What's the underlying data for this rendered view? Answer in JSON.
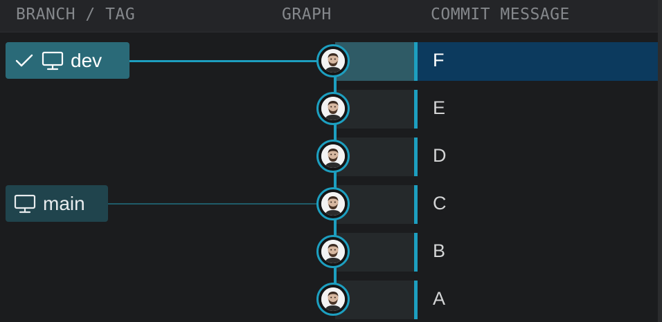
{
  "header": {
    "branch_tag": "BRANCH / TAG",
    "graph": "GRAPH",
    "commit_message": "COMMIT MESSAGE"
  },
  "branches": [
    {
      "name": "dev",
      "is_current": true,
      "icons": [
        "checkmark-icon",
        "computer-icon"
      ]
    },
    {
      "name": "main",
      "is_current": false,
      "icons": [
        "computer-icon"
      ]
    }
  ],
  "commits": [
    {
      "message": "F",
      "selected": true
    },
    {
      "message": "E",
      "selected": false
    },
    {
      "message": "D",
      "selected": false
    },
    {
      "message": "C",
      "selected": false
    },
    {
      "message": "B",
      "selected": false
    },
    {
      "message": "A",
      "selected": false
    }
  ],
  "colors": {
    "background": "#1b1c1e",
    "accent": "#1d9fc0",
    "selected_row": "#0c3a5e",
    "current_branch_label": "#2a6a78",
    "branch_label": "#20444d"
  }
}
